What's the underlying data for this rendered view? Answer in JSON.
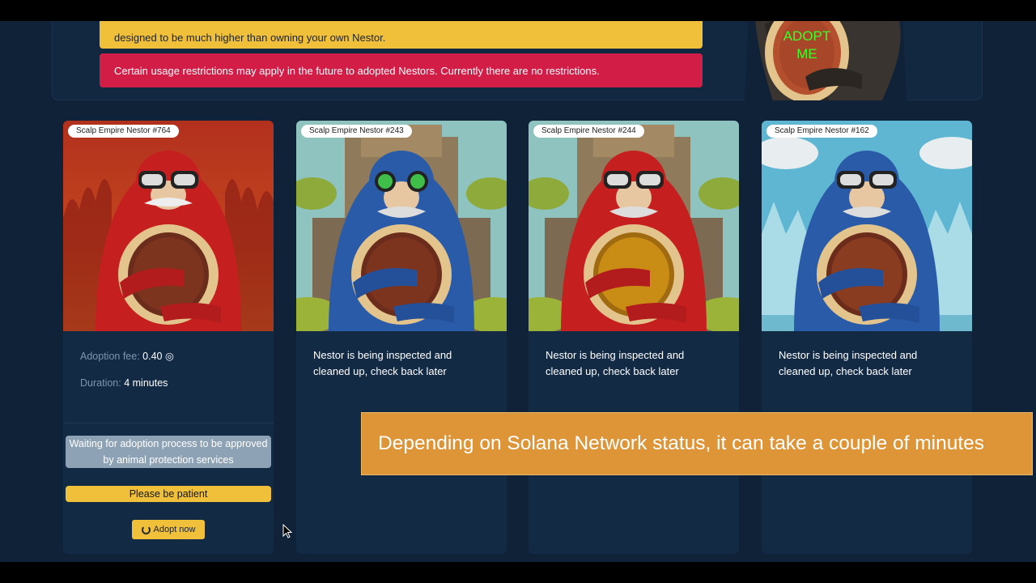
{
  "notices": {
    "yellow_text": "designed to be much higher than owning your own Nestor.",
    "red_text": "Certain usage restrictions may apply in the future to adopted Nestors. Currently there are no restrictions."
  },
  "mascot": {
    "sign_line1": "ADOPT",
    "sign_line2": "ME"
  },
  "cards": [
    {
      "badge": "Scalp Empire Nestor #764",
      "fee_label": "Adoption fee:",
      "fee_value": "0.40 ◎",
      "duration_label": "Duration:",
      "duration_value": "4 minutes",
      "waiting_text": "Waiting for adoption process to be approved by animal protection services",
      "patient_text": "Please be patient",
      "adopt_label": "Adopt now"
    },
    {
      "badge": "Scalp Empire Nestor #243",
      "status": "Nestor is being inspected and cleaned up, check back later"
    },
    {
      "badge": "Scalp Empire Nestor #244",
      "status": "Nestor is being inspected and cleaned up, check back later"
    },
    {
      "badge": "Scalp Empire Nestor #162",
      "status": "Nestor is being inspected and cleaned up, check back later"
    }
  ],
  "caption": "Depending on Solana Network status, it can take a couple of minutes",
  "colors": {
    "accent_yellow": "#f0c03a",
    "alert_red": "#d21d47",
    "background": "#0f2238",
    "caption_orange": "#de9538"
  }
}
